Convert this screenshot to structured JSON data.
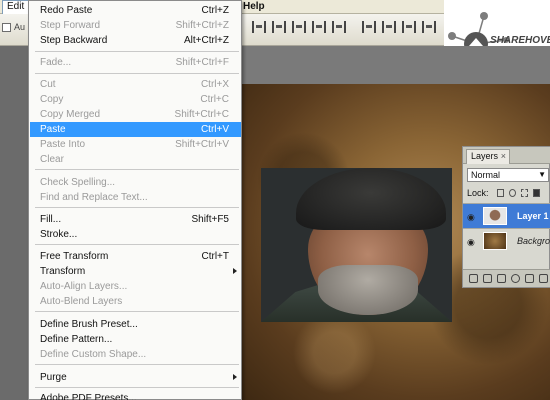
{
  "menubar": {
    "edit_label": "Edit",
    "help_label": "Help"
  },
  "toolbar": {
    "auto_label": "Au"
  },
  "logo": {
    "text": "SHAREHOVEL"
  },
  "edit_menu": {
    "items": [
      {
        "label": "Redo Paste",
        "shortcut": "Ctrl+Z",
        "disabled": false
      },
      {
        "label": "Step Forward",
        "shortcut": "Shift+Ctrl+Z",
        "disabled": true
      },
      {
        "label": "Step Backward",
        "shortcut": "Alt+Ctrl+Z",
        "disabled": false
      },
      {
        "label": "Fade...",
        "shortcut": "Shift+Ctrl+F",
        "disabled": true
      },
      {
        "label": "Cut",
        "shortcut": "Ctrl+X",
        "disabled": true
      },
      {
        "label": "Copy",
        "shortcut": "Ctrl+C",
        "disabled": true
      },
      {
        "label": "Copy Merged",
        "shortcut": "Shift+Ctrl+C",
        "disabled": true
      },
      {
        "label": "Paste",
        "shortcut": "Ctrl+V",
        "disabled": false,
        "selected": true
      },
      {
        "label": "Paste Into",
        "shortcut": "Shift+Ctrl+V",
        "disabled": true
      },
      {
        "label": "Clear",
        "shortcut": "",
        "disabled": true
      },
      {
        "label": "Check Spelling...",
        "shortcut": "",
        "disabled": true
      },
      {
        "label": "Find and Replace Text...",
        "shortcut": "",
        "disabled": true
      },
      {
        "label": "Fill...",
        "shortcut": "Shift+F5",
        "disabled": false
      },
      {
        "label": "Stroke...",
        "shortcut": "",
        "disabled": false
      },
      {
        "label": "Free Transform",
        "shortcut": "Ctrl+T",
        "disabled": false
      },
      {
        "label": "Transform",
        "shortcut": "",
        "disabled": false,
        "submenu": true
      },
      {
        "label": "Auto-Align Layers...",
        "shortcut": "",
        "disabled": true
      },
      {
        "label": "Auto-Blend Layers",
        "shortcut": "",
        "disabled": true
      },
      {
        "label": "Define Brush Preset...",
        "shortcut": "",
        "disabled": false
      },
      {
        "label": "Define Pattern...",
        "shortcut": "",
        "disabled": false
      },
      {
        "label": "Define Custom Shape...",
        "shortcut": "",
        "disabled": true
      },
      {
        "label": "Purge",
        "shortcut": "",
        "disabled": false,
        "submenu": true
      },
      {
        "label": "Adobe PDF Presets...",
        "shortcut": "",
        "disabled": false
      }
    ]
  },
  "layers_panel": {
    "tab_label": "Layers",
    "close_glyph": "×",
    "blend_mode": "Normal",
    "lock_label": "Lock:",
    "layers": [
      {
        "name": "Layer 1",
        "active": true
      },
      {
        "name": "Backgrou",
        "active": false
      }
    ]
  },
  "colors": {
    "menu_highlight": "#3399ff",
    "layer_active": "#3f7bd6"
  }
}
